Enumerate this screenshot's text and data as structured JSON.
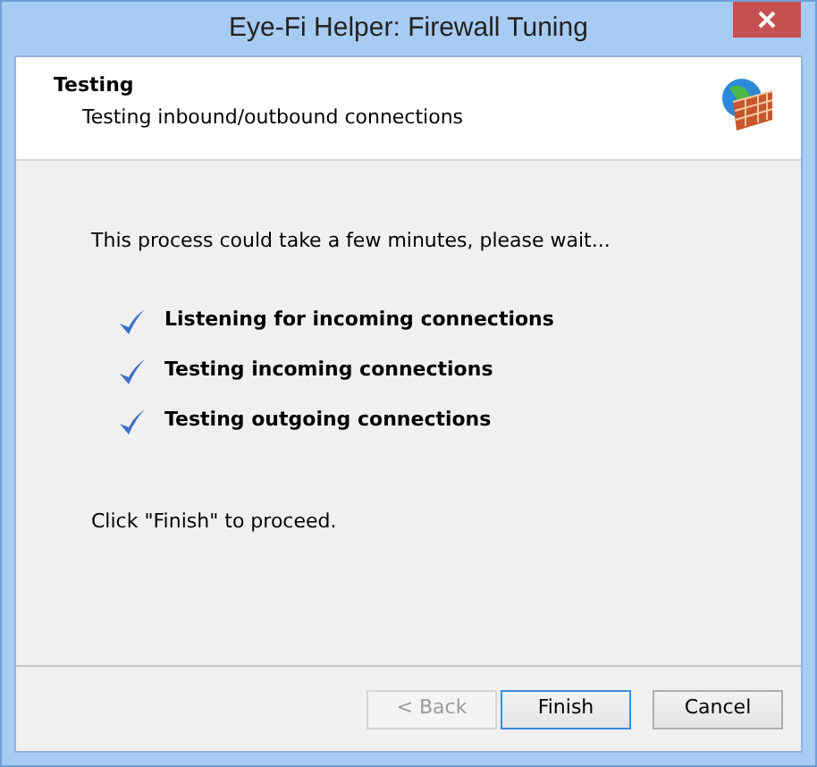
{
  "window": {
    "title": "Eye-Fi Helper: Firewall Tuning"
  },
  "header": {
    "title": "Testing",
    "subtitle": "Testing inbound/outbound connections"
  },
  "message": "This process could take a few minutes, please wait...",
  "steps": [
    {
      "label": "Listening for incoming connections",
      "done": true
    },
    {
      "label": "Testing incoming connections",
      "done": true
    },
    {
      "label": "Testing outgoing connections",
      "done": true
    }
  ],
  "note": "Click \"Finish\" to proceed.",
  "buttons": [
    {
      "label": "< Back",
      "disabled": true,
      "focused": false
    },
    {
      "label": "Finish",
      "disabled": false,
      "focused": true
    },
    {
      "label": "Cancel",
      "disabled": false,
      "focused": false
    }
  ]
}
